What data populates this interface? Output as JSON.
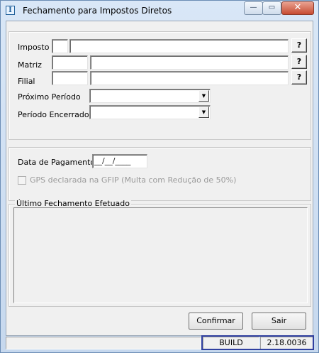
{
  "window": {
    "title": "Fechamento para Impostos Diretos",
    "icon": "app-logo-icon",
    "controls": {
      "minimize_glyph": "—",
      "maximize_glyph": "▭",
      "close_glyph": "✕"
    }
  },
  "form": {
    "imposto_label": "Imposto",
    "matriz_label": "Matriz",
    "filial_label": "Filial",
    "help_button": "?",
    "proximo_periodo_label": "Próximo Período",
    "periodo_encerrado_label": "Período Encerrado"
  },
  "payment": {
    "data_pagamento_label": "Data de Pagamento",
    "data_pagamento_value": "__/__/____",
    "gps_checkbox_label": "GPS declarada na GFIP (Multa com Redução de 50%)"
  },
  "ultimo_fechamento": {
    "legend": "Último Fechamento Efetuado"
  },
  "buttons": {
    "confirmar": "Confirmar",
    "sair": "Sair"
  },
  "status": {
    "build_label": "BUILD",
    "build_version": "2.18.0036"
  },
  "colors": {
    "highlight_border": "#3040a0",
    "close_button": "#c74b32"
  }
}
